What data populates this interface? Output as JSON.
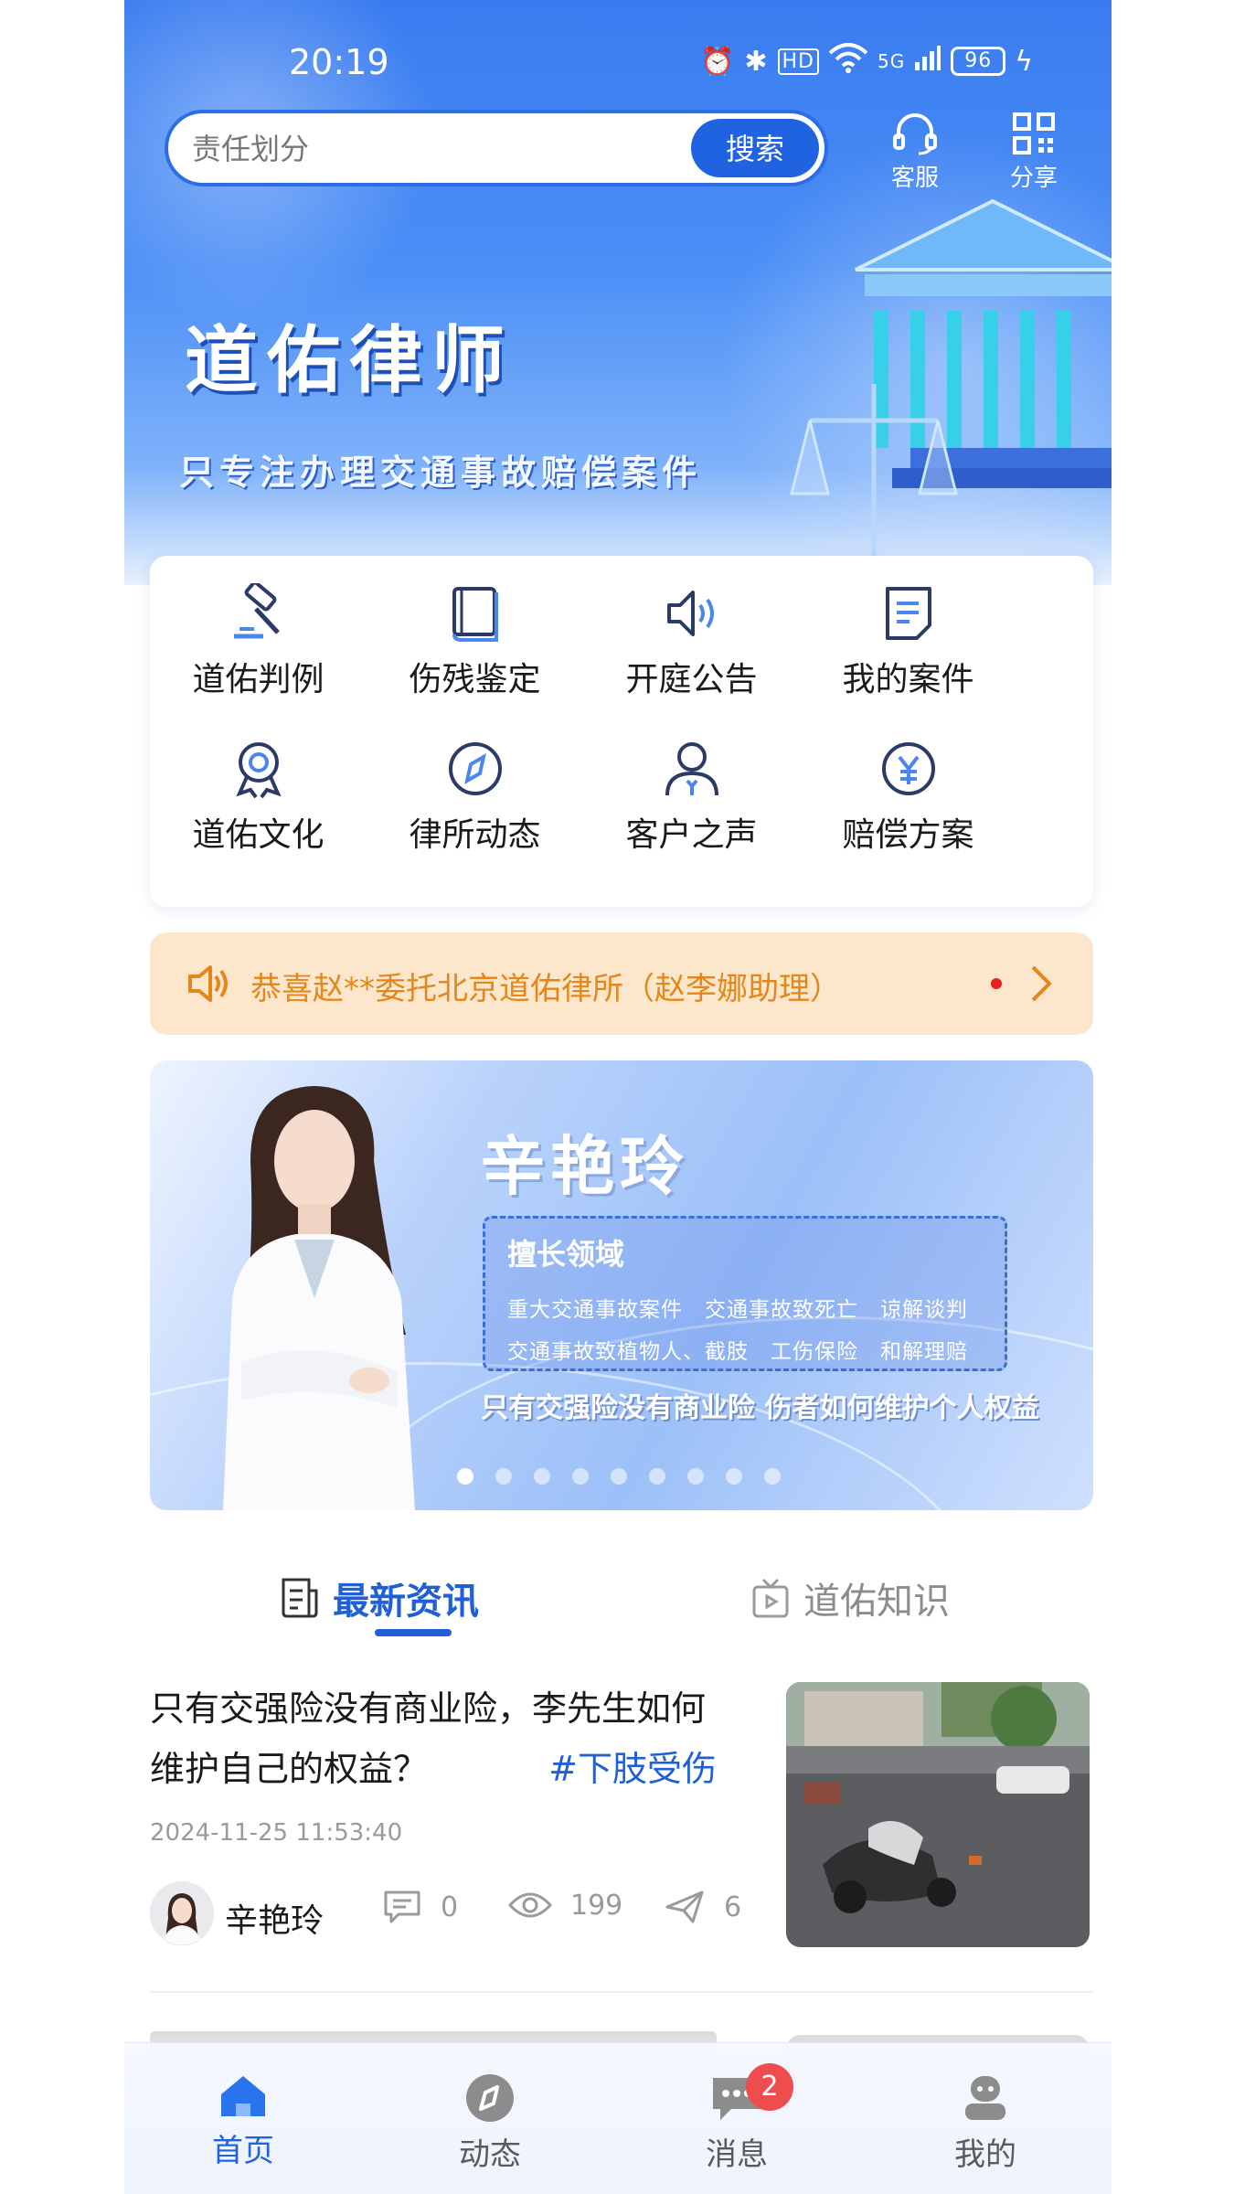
{
  "status_bar": {
    "time": "20:19",
    "network": "5G",
    "hd": "HD",
    "battery": "96"
  },
  "search": {
    "placeholder": "责任划分",
    "button_label": "搜索"
  },
  "top_actions": {
    "service_label": "客服",
    "share_label": "分享"
  },
  "hero": {
    "title": "道佑律师",
    "subtitle": "只专注办理交通事故赔偿案件"
  },
  "menu": [
    {
      "label": "道佑判例",
      "icon": "gavel-icon"
    },
    {
      "label": "伤残鉴定",
      "icon": "book-icon"
    },
    {
      "label": "开庭公告",
      "icon": "speaker-icon"
    },
    {
      "label": "我的案件",
      "icon": "document-icon"
    },
    {
      "label": "道佑文化",
      "icon": "award-icon"
    },
    {
      "label": "律所动态",
      "icon": "compass-icon"
    },
    {
      "label": "客户之声",
      "icon": "user-icon"
    },
    {
      "label": "赔偿方案",
      "icon": "yuan-icon"
    }
  ],
  "notice": {
    "text": "恭喜赵**委托北京道佑律所（赵李娜助理）"
  },
  "banner": {
    "name": "辛艳玲",
    "expertise_title": "擅长领域",
    "expertise_line1": "重大交通事故案件　交通事故致死亡　谅解谈判",
    "expertise_line2": "交通事故致植物人、截肢　工伤保险　和解理赔",
    "tagline": "只有交强险没有商业险 伤者如何维护个人权益",
    "slide_count": 9,
    "active_slide": 1
  },
  "tabs": [
    {
      "label": "最新资讯",
      "active": true
    },
    {
      "label": "道佑知识",
      "active": false
    }
  ],
  "article": {
    "title": "只有交强险没有商业险，李先生如何维护自己的权益？",
    "tag": "#下肢受伤",
    "date": "2024-11-25 11:53:40",
    "author": "辛艳玲",
    "comments": "0",
    "views": "199",
    "shares": "6"
  },
  "bottom_nav": [
    {
      "label": "首页",
      "active": true
    },
    {
      "label": "动态",
      "active": false
    },
    {
      "label": "消息",
      "active": false,
      "badge": "2"
    },
    {
      "label": "我的",
      "active": false
    }
  ],
  "colors": {
    "primary": "#1f63e0",
    "notice_text": "#e4871a",
    "notice_bg": "#fde7cc",
    "badge": "#ef4d4d"
  }
}
